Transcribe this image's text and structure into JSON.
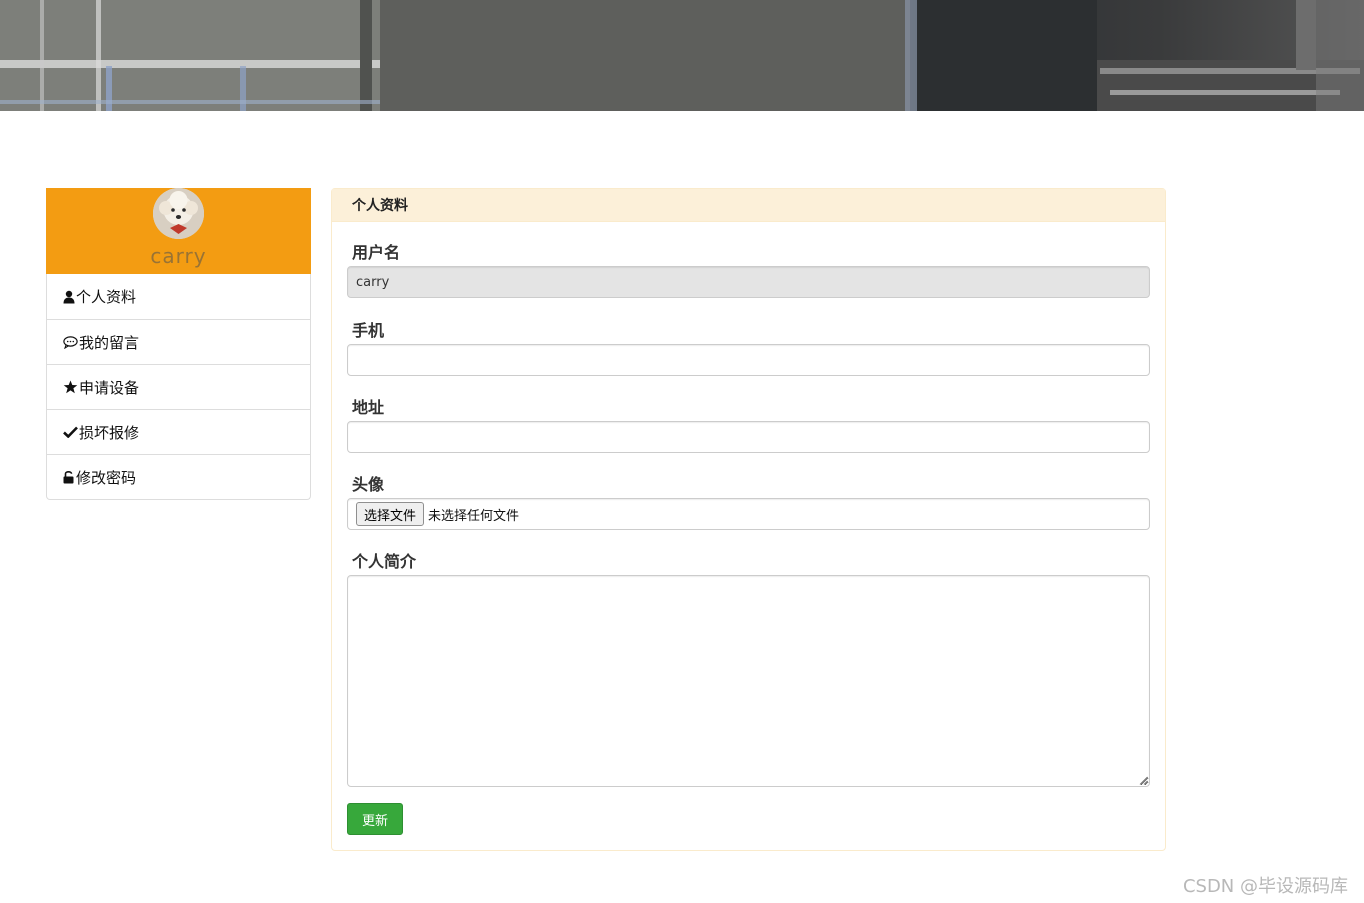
{
  "sidebar": {
    "username": "carry",
    "menu": [
      {
        "label": "个人资料",
        "icon": "user-icon"
      },
      {
        "label": "我的留言",
        "icon": "comment-icon"
      },
      {
        "label": "申请设备",
        "icon": "star-icon"
      },
      {
        "label": "损坏报修",
        "icon": "check-icon"
      },
      {
        "label": "修改密码",
        "icon": "unlock-icon"
      }
    ]
  },
  "panel": {
    "title": "个人资料",
    "fields": {
      "username_label": "用户名",
      "username_value": "carry",
      "phone_label": "手机",
      "phone_value": "",
      "address_label": "地址",
      "address_value": "",
      "avatar_label": "头像",
      "avatar_button": "选择文件",
      "avatar_status": "未选择任何文件",
      "bio_label": "个人简介",
      "bio_value": ""
    },
    "submit_label": "更新"
  },
  "watermark": "CSDN @毕设源码库",
  "colors": {
    "profile_bg": "#f39c12",
    "panel_heading_bg": "#fcf0d9",
    "panel_border": "#faebcc",
    "submit_bg": "#37a83b"
  }
}
